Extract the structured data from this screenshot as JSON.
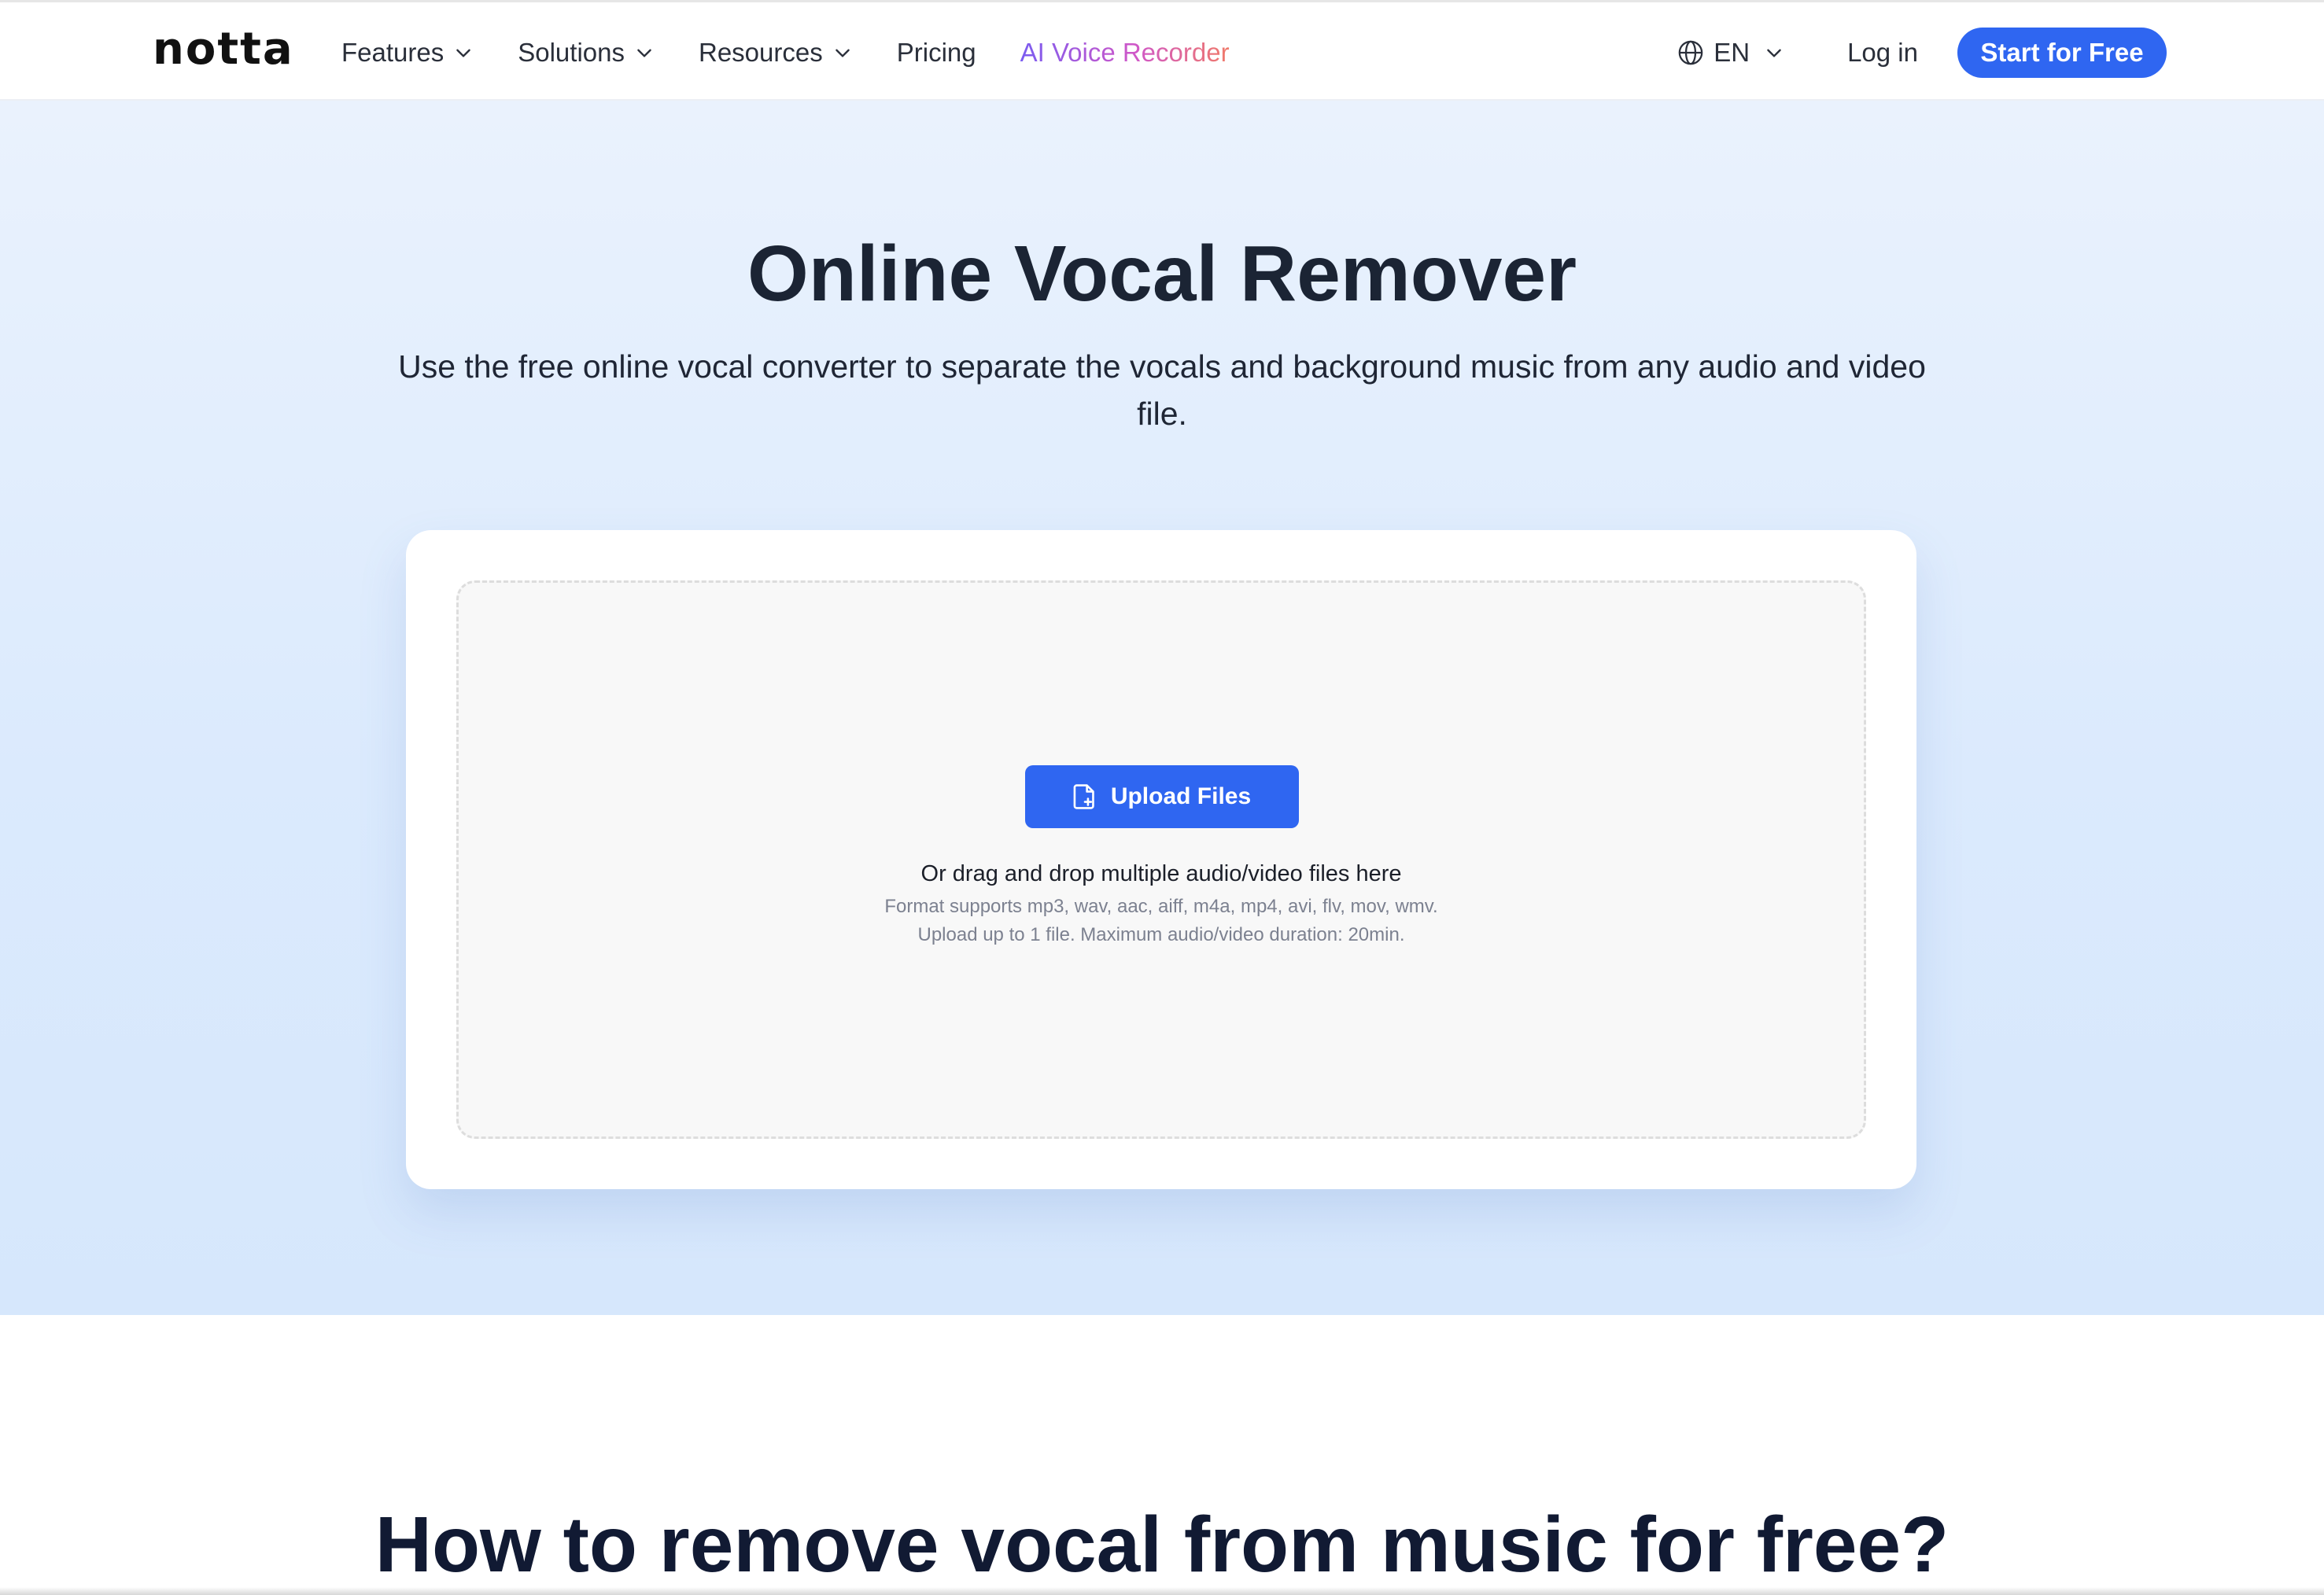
{
  "nav": {
    "logo": "notta",
    "items": [
      {
        "label": "Features",
        "has_dropdown": true
      },
      {
        "label": "Solutions",
        "has_dropdown": true
      },
      {
        "label": "Resources",
        "has_dropdown": true
      },
      {
        "label": "Pricing",
        "has_dropdown": false
      },
      {
        "label": "AI Voice Recorder",
        "has_dropdown": false
      }
    ],
    "language": "EN",
    "login_label": "Log in",
    "cta_label": "Start for Free",
    "icons": [
      "globe-icon",
      "chevron-down-icon"
    ]
  },
  "hero": {
    "title": "Online Vocal Remover",
    "subtitle": "Use the free online vocal converter to separate the vocals and background music from any audio and video file."
  },
  "upload": {
    "button_label": "Upload Files",
    "button_icon": "file-add-icon",
    "drop_text": "Or drag and drop multiple audio/video files here",
    "formats_text": "Format supports mp3, wav, aac, aiff, m4a, mp4, avi, flv, mov, wmv.",
    "limit_text": "Upload up to 1 file. Maximum audio/video duration: 20min."
  },
  "section2": {
    "title": "How to remove vocal from music for free?"
  },
  "colors": {
    "primary": "#2f66f1",
    "heading": "#1b2434",
    "hero_bg_top": "#eaf2fd",
    "hero_bg_bottom": "#d6e7fc",
    "recorder_gradient": [
      "#7b5cf0",
      "#d058c8",
      "#f07a6a"
    ]
  }
}
